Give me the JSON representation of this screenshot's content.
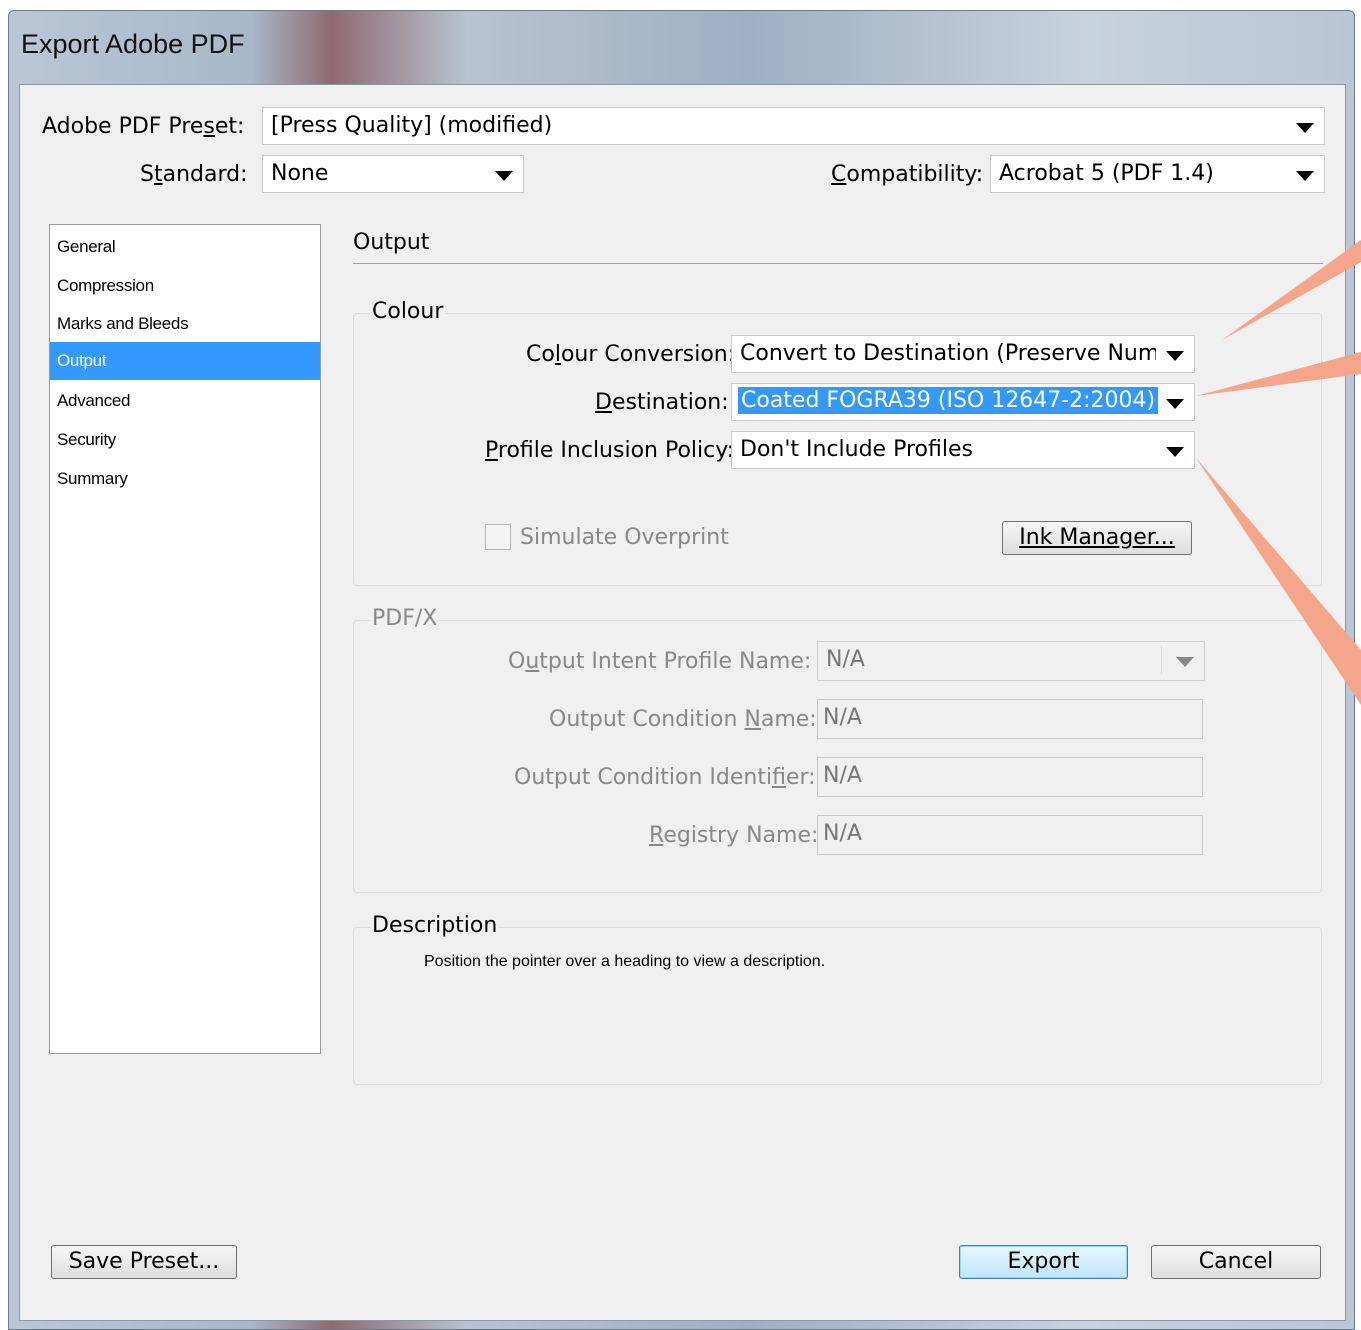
{
  "window": {
    "title": "Export Adobe PDF"
  },
  "header": {
    "preset_label": "Adobe PDF Preset:",
    "preset_value": "[Press Quality] (modified)",
    "standard_label": "Standard:",
    "standard_value": "None",
    "compatibility_label": "Compatibility:",
    "compatibility_value": "Acrobat 5 (PDF 1.4)"
  },
  "sidebar": {
    "items": [
      {
        "label": "General"
      },
      {
        "label": "Compression"
      },
      {
        "label": "Marks and Bleeds"
      },
      {
        "label": "Output"
      },
      {
        "label": "Advanced"
      },
      {
        "label": "Security"
      },
      {
        "label": "Summary"
      }
    ],
    "selected": "Output"
  },
  "main": {
    "section_title": "Output",
    "colour": {
      "title": "Colour",
      "conversion_label": "Colour Conversion:",
      "conversion_value": "Convert to Destination (Preserve Numb",
      "destination_label": "Destination:",
      "destination_value": "Coated FOGRA39 (ISO 12647-2:2004)",
      "profile_label": "Profile Inclusion Policy:",
      "profile_value": "Don't Include Profiles",
      "simulate_label": "Simulate Overprint",
      "ink_manager_label": "Ink Manager..."
    },
    "pdfx": {
      "title": "PDF/X",
      "intent_label": "Output Intent Profile Name:",
      "intent_value": "N/A",
      "condition_name_label": "Output Condition Name:",
      "condition_name_value": "N/A",
      "condition_id_label": "Output Condition Identifier:",
      "condition_id_value": "N/A",
      "registry_label": "Registry Name:",
      "registry_value": "N/A"
    },
    "description": {
      "title": "Description",
      "text": "Position the pointer over a heading to view a description."
    }
  },
  "footer": {
    "save_preset_label": "Save Preset...",
    "export_label": "Export",
    "cancel_label": "Cancel"
  },
  "colors": {
    "selection": "#3399ff",
    "callout": "#f4a58a"
  }
}
